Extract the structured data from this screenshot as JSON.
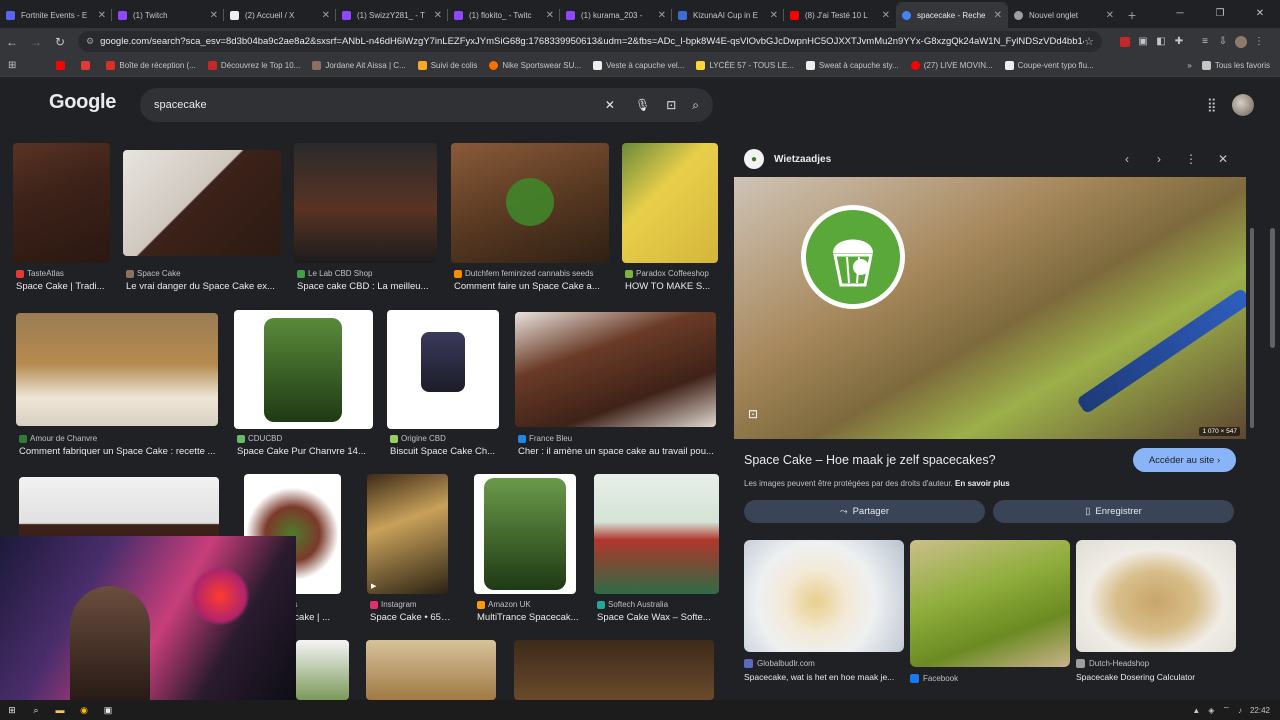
{
  "tabs": [
    {
      "title": "Fortnite Events - E",
      "color": "#5865f2"
    },
    {
      "title": "(1) Twitch",
      "color": "#9146ff"
    },
    {
      "title": "(2) Accueil / X",
      "color": "#000000"
    },
    {
      "title": "(1) SwizzY281_ - T",
      "color": "#9146ff"
    },
    {
      "title": "(1) flokito_ - Twitc",
      "color": "#9146ff"
    },
    {
      "title": "(1) kurama_203 -",
      "color": "#9146ff"
    },
    {
      "title": "KizunaAI Cup in E",
      "color": "#3d6bd1"
    },
    {
      "title": "(8) J'ai Testé 10 L",
      "color": "#ff0000"
    },
    {
      "title": "spacecake - Reche",
      "color": "#4285f4",
      "active": true
    },
    {
      "title": "Nouvel onglet",
      "color": "#9aa0a6"
    }
  ],
  "url": "google.com/search?sca_esv=8d3b04ba9c2ae8a2&sxsrf=ANbL-n46dH6iWzgY7inLEZFyxJYmSiG68g:1768339950613&udm=2&fbs=ADc_l-bpk8W4E-qsVlOvbGJcDwpnHC5OJXXTJvmMu2n9YYx-G8xzgQk24aW1N_FylNDSzVDd4bb14119C8nZ...",
  "bookmarks": [
    {
      "label": "",
      "color": "#ff0000"
    },
    {
      "label": "",
      "color": "#e53935"
    },
    {
      "label": "Boîte de réception (...",
      "color": "#d93025"
    },
    {
      "label": "Découvrez le Top 10...",
      "color": "#c62828"
    },
    {
      "label": "Jordane Ait Aissa | C...",
      "color": "#8d6e63"
    },
    {
      "label": "Suivi de colis",
      "color": "#f9a825"
    },
    {
      "label": "Nike Sportswear SU...",
      "color": "#ff6f00"
    },
    {
      "label": "Veste à capuche vel...",
      "color": "#eeeeee"
    },
    {
      "label": "LYCÉE 57 - TOUS LE...",
      "color": "#fdd835"
    },
    {
      "label": "Sweat à capuche sty...",
      "color": "#eeeeee"
    },
    {
      "label": "(27) LIVE MOVIN...",
      "color": "#ff0000"
    },
    {
      "label": "Coupe-vent typo flu...",
      "color": "#eeeeee"
    }
  ],
  "bookmarks_more": "Tous les favoris",
  "google": {
    "logo": "Google"
  },
  "search": {
    "query": "spacecake"
  },
  "results": [
    {
      "source": "TasteAtlas",
      "title": "Space Cake | Tradi...",
      "color": "#e53935"
    },
    {
      "source": "Space Cake",
      "title": "Le vrai danger du Space Cake ex...",
      "color": "#8d6e63"
    },
    {
      "source": "Le Lab CBD Shop",
      "title": "Space cake CBD : La meilleu...",
      "color": "#43a047"
    },
    {
      "source": "Dutchfem feminized cannabis seeds",
      "title": "Comment faire un Space Cake a...",
      "color": "#fb8c00"
    },
    {
      "source": "Paradox Coffeeshop",
      "title": "HOW TO MAKE S...",
      "color": "#7cb342"
    },
    {
      "source": "Amour de Chanvre",
      "title": "Comment fabriquer un Space Cake : recette ...",
      "color": "#2e7d32"
    },
    {
      "source": "CDUCBD",
      "title": "Space Cake Pur Chanvre 14...",
      "color": "#66bb6a"
    },
    {
      "source": "Origine CBD",
      "title": "Biscuit Space Cake Ch...",
      "color": "#9ccc65"
    },
    {
      "source": "France Bleu",
      "title": "Cher : il amène un space cake au travail pou...",
      "color": "#1e88e5"
    },
    {
      "source": "es",
      "title": "ecake | ...",
      "color": "#9e9e9e"
    },
    {
      "source": "Instagram",
      "title": "Space Cake • 655...",
      "color": "#e1306c"
    },
    {
      "source": "Amazon UK",
      "title": "MultiTrance Spacecak...",
      "color": "#ff9900"
    },
    {
      "source": "Softech Australia",
      "title": "Space Cake Wax – Softe...",
      "color": "#26a69a"
    }
  ],
  "panel": {
    "site_name": "Wietzaadjes",
    "dimensions": "1 070 × 547",
    "title": "Space Cake – Hoe maak je zelf spacecakes?",
    "visit_label": "Accéder au site",
    "copyright_text": "Les images peuvent être protégées par des droits d'auteur.",
    "learn_more": "En savoir plus",
    "share_label": "Partager",
    "save_label": "Enregistrer",
    "related": [
      {
        "source": "Globalbudlr.com",
        "title": "Spacecake, wat is het en hoe maak je...",
        "color": "#5c6bc0"
      },
      {
        "source": "Facebook",
        "title": "",
        "color": "#1877f2"
      },
      {
        "source": "Dutch-Headshop",
        "title": "Spacecake Dosering Calculator",
        "color": "#9e9e9e"
      }
    ]
  },
  "taskbar": {
    "time": "22:42"
  }
}
